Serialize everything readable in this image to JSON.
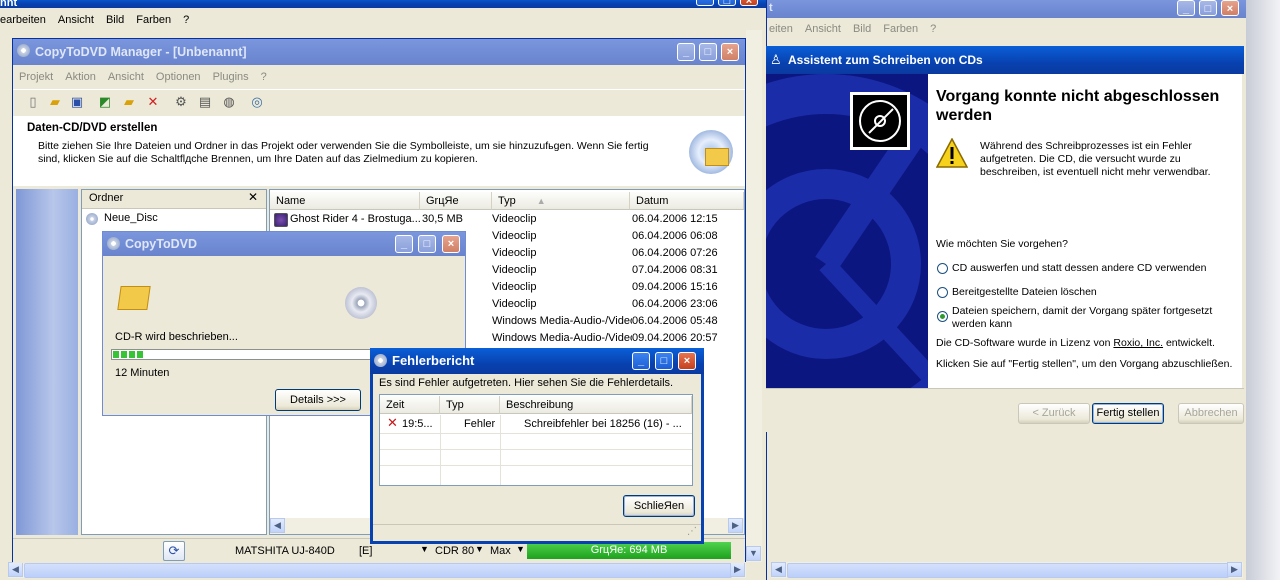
{
  "bg_window": {
    "title": "nnt",
    "menu": [
      "earbeiten",
      "Ansicht",
      "Bild",
      "Farben",
      "?"
    ]
  },
  "manager": {
    "title": "CopyToDVD Manager - [Unbenannt]",
    "menu": [
      "Projekt",
      "Aktion",
      "Ansicht",
      "Optionen",
      "Plugins",
      "?"
    ],
    "header_title": "Daten-CD/DVD erstellen",
    "header_text": "Bitte ziehen Sie Ihre Dateien und Ordner in das Projekt oder verwenden Sie die Symbolleiste, um sie hinzuzufьgen. Wenn Sie fertig sind, klicken Sie auf die Schaltflдche Brennen, um Ihre Daten auf das Zielmedium zu kopieren.",
    "folder_panel_title": "Ordner",
    "folder_root": "Neue_Disc",
    "columns": [
      "Name",
      "GrцЯe",
      "Typ",
      "Datum"
    ],
    "rows": [
      {
        "name": "Ghost Rider 4 - Brostuga...",
        "size": "30,5 MB",
        "type": "Videoclip",
        "date": "06.04.2006 12:15"
      },
      {
        "name": "",
        "size": "",
        "type": "Videoclip",
        "date": "06.04.2006 06:08"
      },
      {
        "name": "",
        "size": "",
        "type": "Videoclip",
        "date": "06.04.2006 07:26"
      },
      {
        "name": "",
        "size": "",
        "type": "Videoclip",
        "date": "07.04.2006 08:31"
      },
      {
        "name": "",
        "size": "",
        "type": "Videoclip",
        "date": "09.04.2006 15:16"
      },
      {
        "name": "",
        "size": "",
        "type": "Videoclip",
        "date": "06.04.2006 23:06"
      },
      {
        "name": "",
        "size": "",
        "type": "Windows Media-Audio-/Video...",
        "date": "06.04.2006 05:48"
      },
      {
        "name": "",
        "size": "",
        "type": "Windows Media-Audio-/Video...",
        "date": "09.04.2006 20:57"
      }
    ],
    "status": {
      "drive": "MATSHITA UJ-840D",
      "drive_letter": "[E]",
      "speed": "CDR 80",
      "mode": "Max",
      "size": "GrцЯe: 694 MB"
    }
  },
  "progress_dialog": {
    "title": "CopyToDVD",
    "status": "CD-R wird beschrieben...",
    "progress": 0.09,
    "time": "12 Minuten",
    "details_button": "Details >>>"
  },
  "error_dialog": {
    "title": "Fehlerbericht",
    "message": "Es sind Fehler aufgetreten. Hier sehen Sie die Fehlerdetails.",
    "columns": [
      "Zeit",
      "Typ",
      "Beschreibung"
    ],
    "rows": [
      {
        "time": "19:5...",
        "type": "Fehler",
        "desc": "Schreibfehler bei 18256 (16) - ..."
      }
    ],
    "close_button": "SchlieЯen"
  },
  "wizard": {
    "bg_title": "t",
    "bg_menu": [
      "eiten",
      "Ansicht",
      "Bild",
      "Farben",
      "?"
    ],
    "title": "Assistent zum Schreiben von CDs",
    "heading": "Vorgang konnte nicht abgeschlossen werden",
    "warning": "Während des Schreibprozesses ist ein Fehler aufgetreten. Die CD, die versucht wurde zu beschreiben, ist eventuell nicht mehr verwendbar.",
    "question": "Wie möchten Sie vorgehen?",
    "options": [
      {
        "label": "CD auswerfen und statt dessen andere CD verwenden",
        "selected": false
      },
      {
        "label": "Bereitgestellte Dateien löschen",
        "selected": false
      },
      {
        "label": "Dateien speichern, damit der Vorgang später fortgesetzt werden kann",
        "selected": true
      }
    ],
    "license_prefix": "Die CD-Software wurde in Lizenz von ",
    "license_link": "Roxio, Inc.",
    "license_suffix": " entwickelt.",
    "finish_hint": "Klicken Sie auf \"Fertig stellen\", um den Vorgang abzuschließen.",
    "buttons": {
      "back": "< Zurück",
      "finish": "Fertig stellen",
      "cancel": "Abbrechen"
    }
  },
  "colors": {
    "xp_blue": "#0842b0",
    "wizard_side": "#101a8a",
    "progress_green": "#2fbf2f"
  }
}
